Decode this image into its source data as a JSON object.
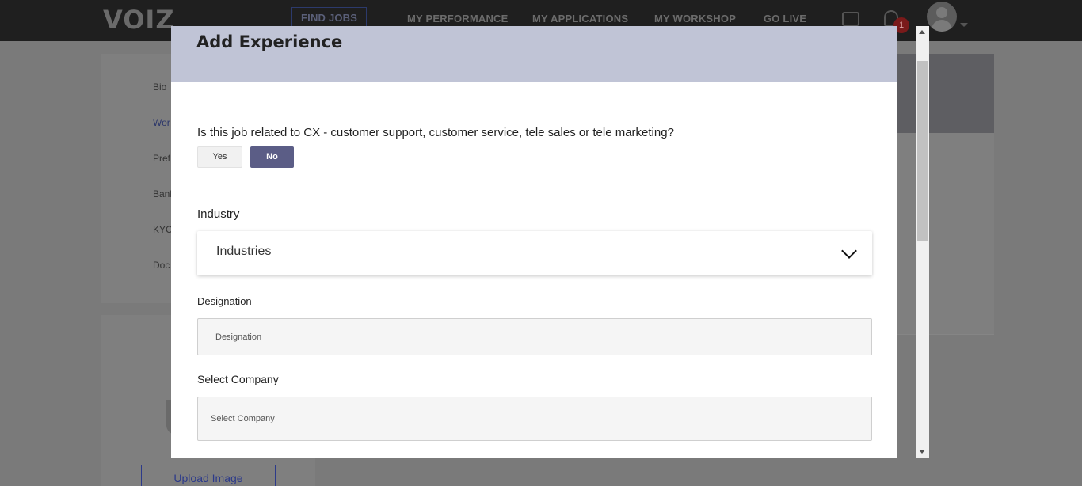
{
  "nav": {
    "logo": "VOIZ",
    "items": [
      {
        "label": "FIND JOBS"
      },
      {
        "label": "MY PERFORMANCE"
      },
      {
        "label": "MY APPLICATIONS"
      },
      {
        "label": "MY WORKSHOP"
      },
      {
        "label": "GO LIVE"
      }
    ],
    "notification_count": "1"
  },
  "sidebar": {
    "items": [
      {
        "label": "Bio"
      },
      {
        "label": "Wor"
      },
      {
        "label": "Pref"
      },
      {
        "label": "Banl"
      },
      {
        "label": "KYC"
      },
      {
        "label": "Doc"
      }
    ],
    "upload_label": "Upload Image"
  },
  "modal": {
    "title": "Add Experience",
    "question": "Is this job related to CX - customer support, customer service, tele sales or tele marketing?",
    "yes_label": "Yes",
    "no_label": "No",
    "selected": "No",
    "industry_label": "Industry",
    "industry_value": "Industries",
    "designation_label": "Designation",
    "designation_placeholder": "Designation",
    "company_label": "Select Company",
    "company_placeholder": "Select Company"
  },
  "colors": {
    "accent": "#5b5d86",
    "modal_header": "#c0c4d6",
    "topbar": "#1f1f1f"
  }
}
